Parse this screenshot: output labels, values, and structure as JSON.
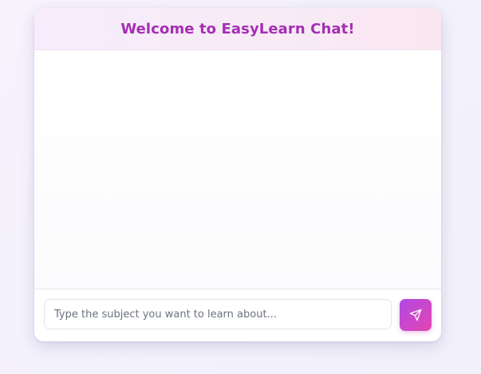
{
  "chat": {
    "title": "Welcome to EasyLearn Chat!",
    "messages": []
  },
  "input": {
    "value": "",
    "placeholder": "Type the subject you want to learn about..."
  },
  "send_button": {
    "icon": "send-icon"
  },
  "colors": {
    "accent_start": "#b148e2",
    "accent_end": "#e346b2",
    "title": "#a42fb3"
  }
}
